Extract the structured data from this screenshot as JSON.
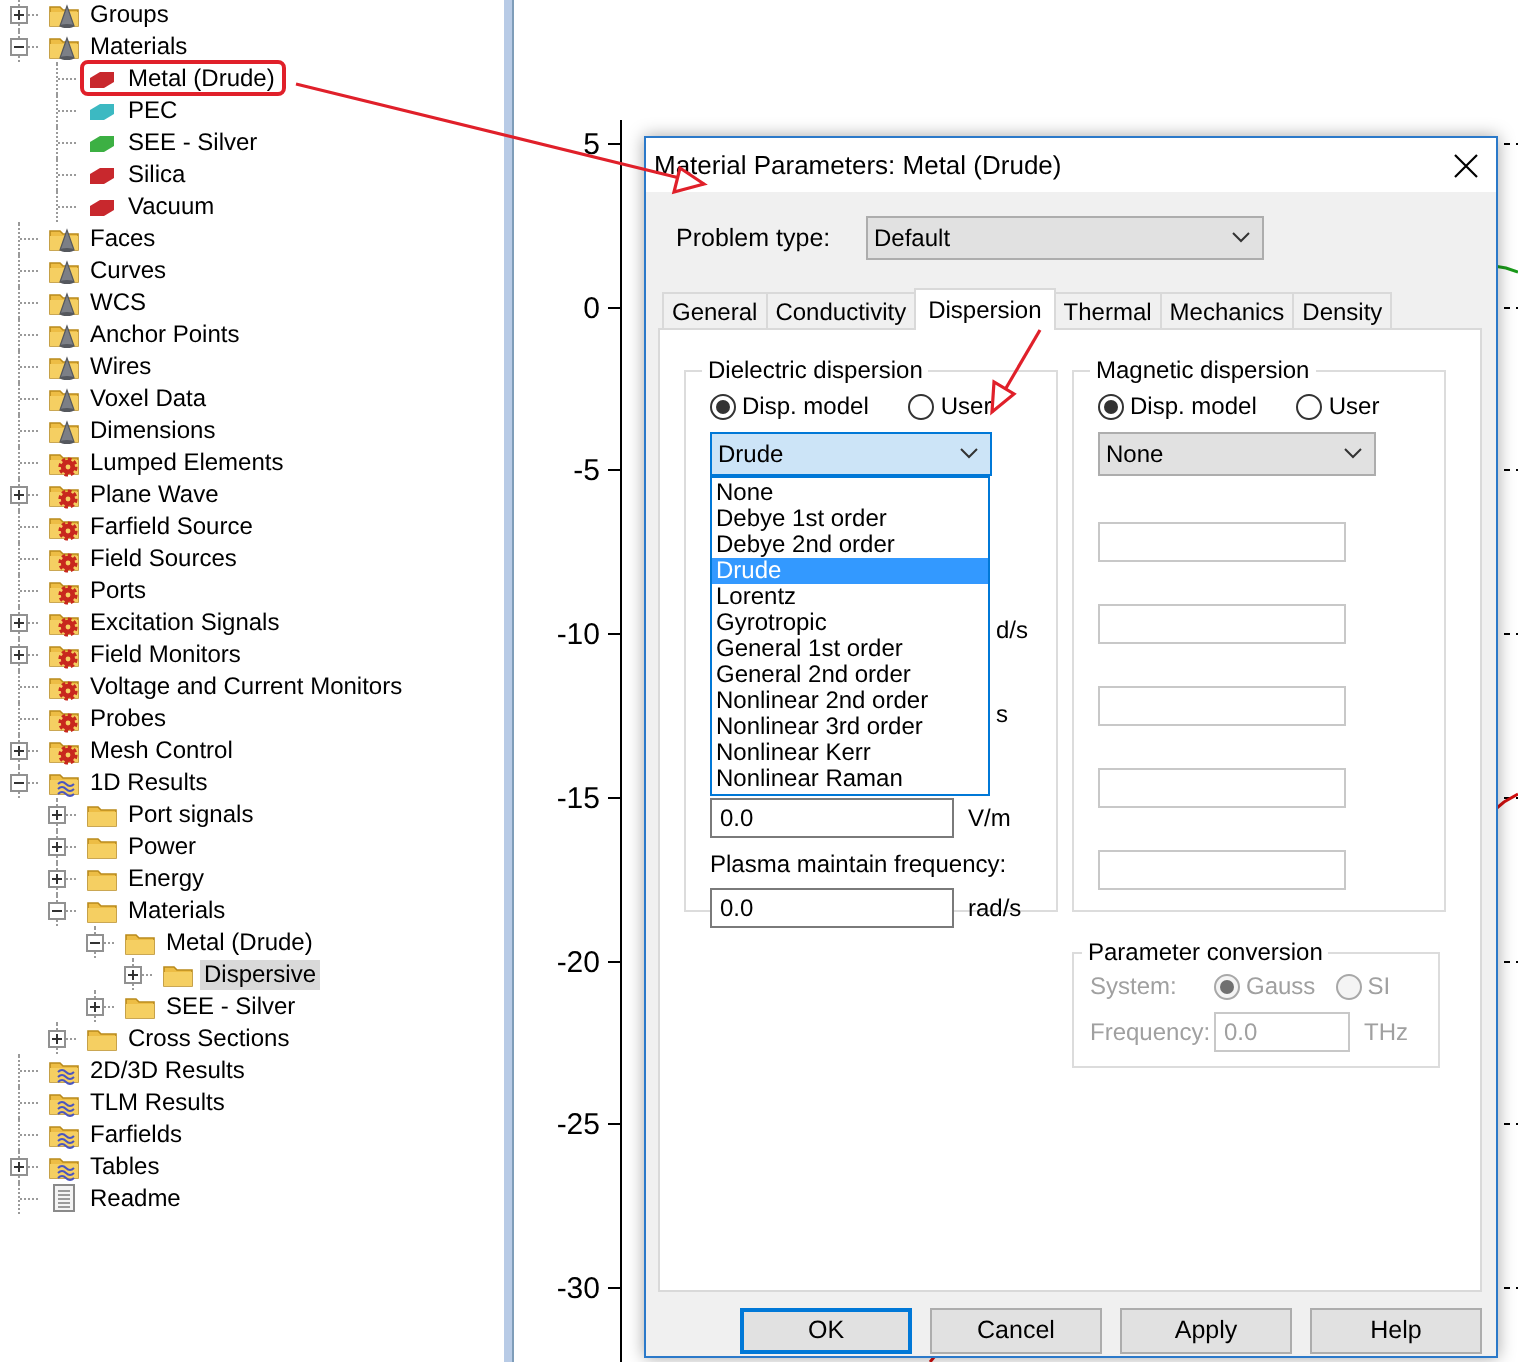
{
  "tree": [
    {
      "label": "Groups",
      "kind": "cone-folder",
      "expanded": false,
      "selected": false
    },
    {
      "label": "Materials",
      "kind": "cone-folder",
      "expanded": true,
      "selected": false,
      "children": [
        {
          "label": "Metal (Drude)",
          "kind": "material",
          "color": "#c8282d",
          "selected": false,
          "highlighted": true
        },
        {
          "label": "PEC",
          "kind": "material",
          "color": "#3cb9c2",
          "selected": false
        },
        {
          "label": "SEE - Silver",
          "kind": "material",
          "color": "#3cb043",
          "selected": false
        },
        {
          "label": "Silica",
          "kind": "material",
          "color": "#c8282d",
          "selected": false
        },
        {
          "label": "Vacuum",
          "kind": "material",
          "color": "#c8282d",
          "selected": false
        }
      ]
    },
    {
      "label": "Faces",
      "kind": "cone-folder",
      "selected": false
    },
    {
      "label": "Curves",
      "kind": "cone-folder",
      "selected": false
    },
    {
      "label": "WCS",
      "kind": "cone-folder",
      "selected": false
    },
    {
      "label": "Anchor Points",
      "kind": "cone-folder",
      "selected": false
    },
    {
      "label": "Wires",
      "kind": "cone-folder",
      "selected": false
    },
    {
      "label": "Voxel Data",
      "kind": "cone-folder",
      "selected": false
    },
    {
      "label": "Dimensions",
      "kind": "cone-folder",
      "selected": false
    },
    {
      "label": "Lumped Elements",
      "kind": "gear-folder",
      "selected": false
    },
    {
      "label": "Plane Wave",
      "kind": "gear-folder",
      "expanded": false,
      "selected": false
    },
    {
      "label": "Farfield Source",
      "kind": "gear-folder",
      "selected": false
    },
    {
      "label": "Field Sources",
      "kind": "gear-folder",
      "selected": false
    },
    {
      "label": "Ports",
      "kind": "gear-folder",
      "selected": false
    },
    {
      "label": "Excitation Signals",
      "kind": "gear-folder",
      "expanded": false,
      "selected": false
    },
    {
      "label": "Field Monitors",
      "kind": "gear-folder",
      "expanded": false,
      "selected": false
    },
    {
      "label": "Voltage and Current Monitors",
      "kind": "gear-folder",
      "selected": false
    },
    {
      "label": "Probes",
      "kind": "gear-folder",
      "selected": false
    },
    {
      "label": "Mesh Control",
      "kind": "gear-folder",
      "expanded": false,
      "selected": false
    },
    {
      "label": "1D Results",
      "kind": "wave-folder",
      "expanded": true,
      "selected": false,
      "children": [
        {
          "label": "Port signals",
          "kind": "folder",
          "expanded": false,
          "selected": false
        },
        {
          "label": "Power",
          "kind": "folder",
          "expanded": false,
          "selected": false
        },
        {
          "label": "Energy",
          "kind": "folder",
          "expanded": false,
          "selected": false
        },
        {
          "label": "Materials",
          "kind": "folder",
          "expanded": true,
          "selected": false,
          "children": [
            {
              "label": "Metal (Drude)",
              "kind": "folder",
              "expanded": true,
              "selected": false,
              "children": [
                {
                  "label": "Dispersive",
                  "kind": "folder",
                  "expanded": false,
                  "selected": true
                }
              ]
            },
            {
              "label": "SEE - Silver",
              "kind": "folder",
              "expanded": false,
              "selected": false
            }
          ]
        },
        {
          "label": "Cross Sections",
          "kind": "folder",
          "expanded": false,
          "selected": false
        }
      ]
    },
    {
      "label": "2D/3D Results",
      "kind": "wave-folder",
      "selected": false
    },
    {
      "label": "TLM Results",
      "kind": "wave-folder",
      "selected": false
    },
    {
      "label": "Farfields",
      "kind": "wave-folder",
      "selected": false
    },
    {
      "label": "Tables",
      "kind": "wave-folder",
      "expanded": false,
      "selected": false
    },
    {
      "label": "Readme",
      "kind": "document",
      "selected": false
    }
  ],
  "plot": {
    "y_tick_labels": [
      "5",
      "0",
      "-5",
      "-10",
      "-15",
      "-20",
      "-25",
      "-30"
    ]
  },
  "dialog": {
    "title": "Material Parameters: Metal (Drude)",
    "problem_type": {
      "label": "Problem type:",
      "value": "Default"
    },
    "tabs": [
      {
        "label": "General",
        "selected": false
      },
      {
        "label": "Conductivity",
        "selected": false
      },
      {
        "label": "Dispersion",
        "selected": true
      },
      {
        "label": "Thermal",
        "selected": false
      },
      {
        "label": "Mechanics",
        "selected": false
      },
      {
        "label": "Density",
        "selected": false
      }
    ],
    "dielectric": {
      "title": "Dielectric dispersion",
      "radios": [
        {
          "label": "Disp. model",
          "selected": true
        },
        {
          "label": "User",
          "selected": false
        }
      ],
      "model": {
        "value": "Drude",
        "expanded": true
      },
      "options": [
        {
          "label": "None",
          "selected": false
        },
        {
          "label": "Debye 1st order",
          "selected": false
        },
        {
          "label": "Debye 2nd order",
          "selected": false
        },
        {
          "label": "Drude",
          "selected": true
        },
        {
          "label": "Lorentz",
          "selected": false
        },
        {
          "label": "Gyrotropic",
          "selected": false
        },
        {
          "label": "General 1st order",
          "selected": false
        },
        {
          "label": "General 2nd order",
          "selected": false
        },
        {
          "label": "Nonlinear 2nd order",
          "selected": false
        },
        {
          "label": "Nonlinear 3rd order",
          "selected": false
        },
        {
          "label": "Nonlinear Kerr",
          "selected": false
        },
        {
          "label": "Nonlinear Raman",
          "selected": false
        }
      ],
      "covered_units": [
        "d/s",
        "s"
      ],
      "field": {
        "value": "0.0",
        "unit": "V/m"
      },
      "plasma": {
        "label": "Plasma maintain frequency:",
        "value": "0.0",
        "unit": "rad/s"
      }
    },
    "magnetic": {
      "title": "Magnetic dispersion",
      "radios": [
        {
          "label": "Disp. model",
          "selected": true
        },
        {
          "label": "User",
          "selected": false
        }
      ],
      "model": {
        "value": "None",
        "expanded": false
      },
      "fields": [
        {
          "kind": "empty"
        },
        {
          "kind": "empty"
        },
        {
          "kind": "empty"
        },
        {
          "kind": "empty"
        },
        {
          "kind": "empty"
        }
      ]
    },
    "conversion": {
      "title": "Parameter conversion",
      "disabled": true,
      "system_label": "System:",
      "radios": [
        {
          "label": "Gauss",
          "selected": true
        },
        {
          "label": "SI",
          "selected": false
        }
      ],
      "frequency_label": "Frequency:",
      "frequency": "0.0",
      "unit": "THz"
    },
    "buttons": [
      {
        "label": "OK",
        "focused": true
      },
      {
        "label": "Cancel",
        "focused": false
      },
      {
        "label": "Apply",
        "focused": false
      },
      {
        "label": "Help",
        "focused": false
      }
    ]
  }
}
